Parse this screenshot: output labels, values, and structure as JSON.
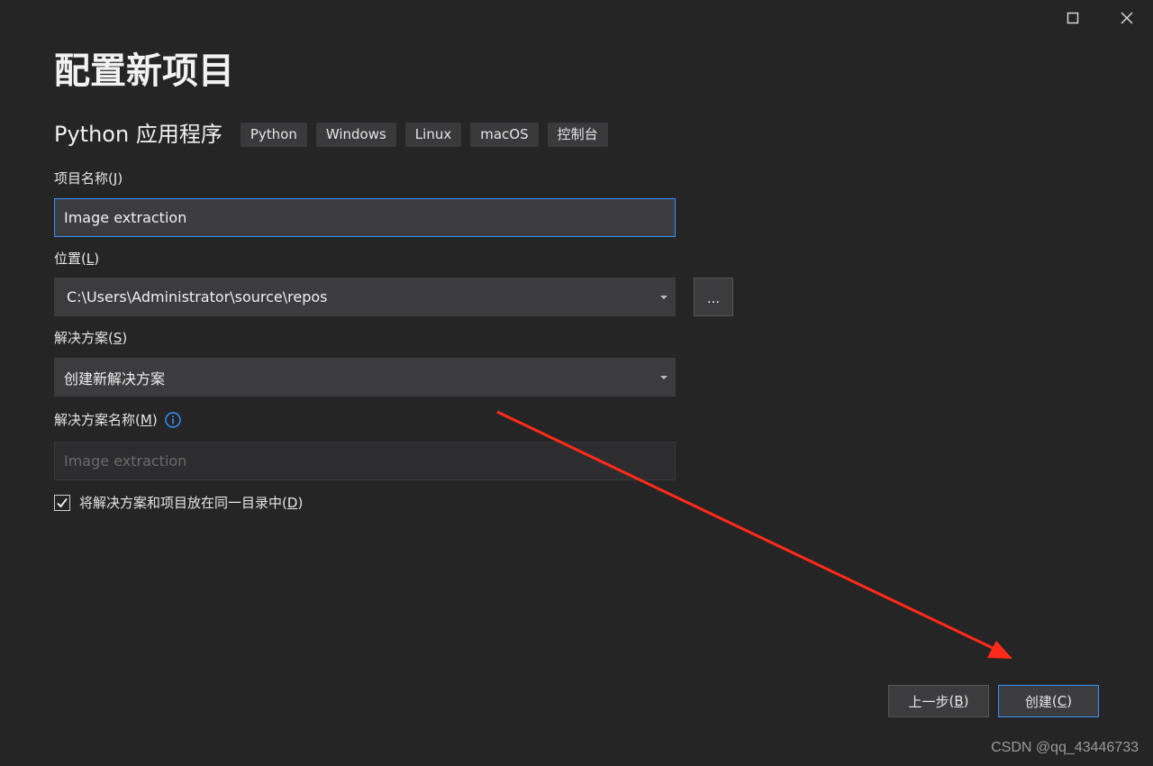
{
  "window": {
    "maximize_icon": "maximize-icon",
    "close_icon": "close-icon"
  },
  "title": "配置新项目",
  "template": {
    "name": "Python 应用程序",
    "tags": [
      "Python",
      "Windows",
      "Linux",
      "macOS",
      "控制台"
    ]
  },
  "project_name": {
    "label": "项目名称",
    "hotkey": "J",
    "value": "Image extraction"
  },
  "location": {
    "label": "位置",
    "hotkey": "L",
    "value": "C:\\Users\\Administrator\\source\\repos",
    "browse_label": "..."
  },
  "solution": {
    "label": "解决方案",
    "hotkey": "S",
    "value": "创建新解决方案"
  },
  "solution_name": {
    "label": "解决方案名称",
    "hotkey": "M",
    "placeholder": "Image extraction",
    "info_icon": "info-icon"
  },
  "same_directory": {
    "checked": true,
    "label": "将解决方案和项目放在同一目录中",
    "hotkey": "D"
  },
  "buttons": {
    "back_label": "上一步",
    "back_hotkey": "B",
    "create_label": "创建",
    "create_hotkey": "C"
  },
  "watermark": "CSDN @qq_43446733",
  "colors": {
    "background": "#252526",
    "field": "#3c3c3f",
    "accent": "#3794ff",
    "annotation_arrow": "#ff2a1a"
  }
}
